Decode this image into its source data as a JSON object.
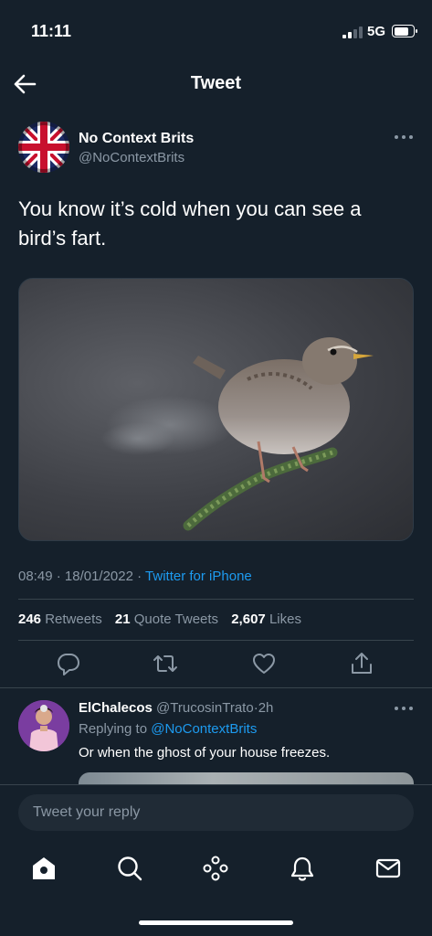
{
  "status_bar": {
    "time": "11:11",
    "network": "5G"
  },
  "header": {
    "title": "Tweet",
    "back_icon": "back-arrow-icon"
  },
  "tweet": {
    "author_name": "No Context Brits",
    "author_handle": "@NoContextBrits",
    "text": "You know it’s cold when you can see a bird’s fart.",
    "time": "08:49",
    "separator": "·",
    "date": "18/01/2022",
    "source": "Twitter for iPhone",
    "stats": {
      "retweets_count": "246",
      "retweets_label": "Retweets",
      "quotes_count": "21",
      "quotes_label": "Quote Tweets",
      "likes_count": "2,607",
      "likes_label": "Likes"
    }
  },
  "actions": {
    "reply_icon": "reply-icon",
    "retweet_icon": "retweet-icon",
    "like_icon": "heart-icon",
    "share_icon": "share-icon"
  },
  "reply": {
    "author_name": "ElChalecos",
    "author_handle": "@TrucosinTrato",
    "separator": "·",
    "time": "2h",
    "replying_to_label": "Replying to",
    "replying_to_handle": "@NoContextBrits",
    "text": "Or when the ghost of your house freezes."
  },
  "compose": {
    "placeholder": "Tweet your reply"
  },
  "tab_bar": {
    "home_icon": "home-icon",
    "search_icon": "search-icon",
    "spaces_icon": "spaces-icon",
    "notifications_icon": "bell-icon",
    "messages_icon": "mail-icon"
  },
  "colors": {
    "background": "#15202b",
    "accent": "#1d9bf0",
    "secondary_text": "#8b98a5",
    "divider": "#38444d"
  }
}
